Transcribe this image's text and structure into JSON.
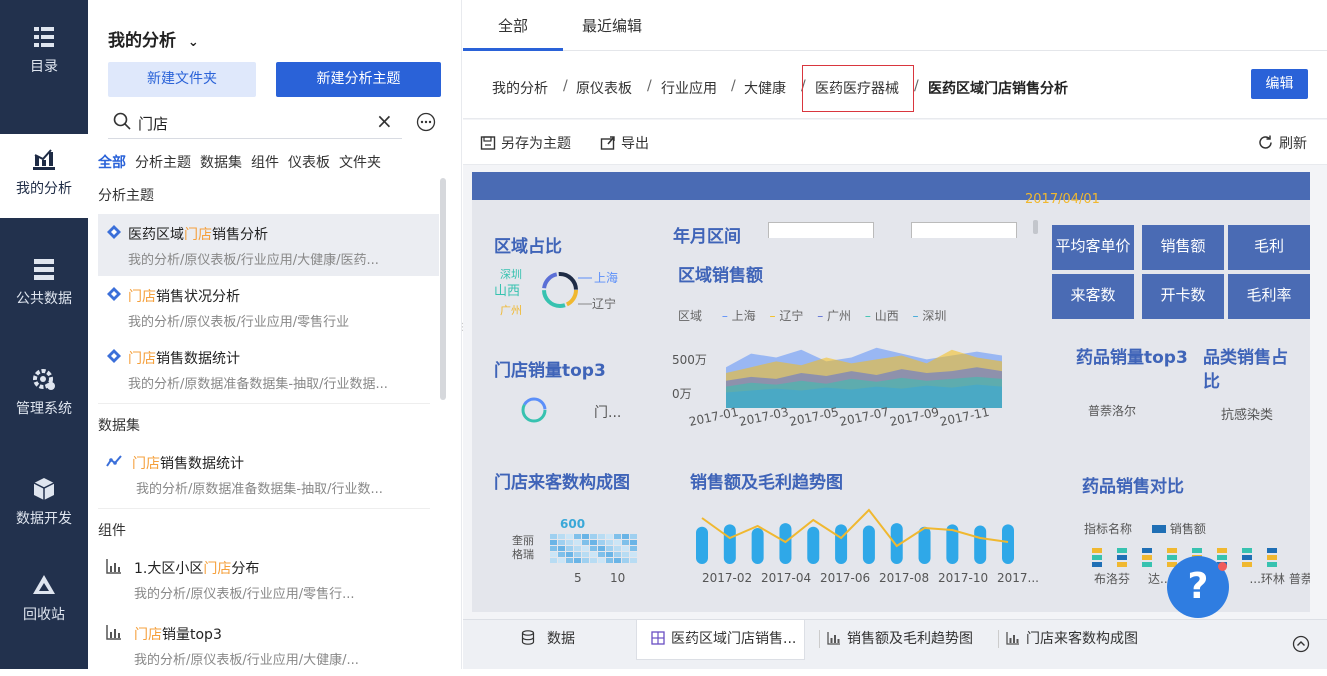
{
  "nav": {
    "items": [
      {
        "label": "目录",
        "icon": "catalog-icon"
      },
      {
        "label": "我的分析",
        "icon": "analysis-icon"
      },
      {
        "label": "公共数据",
        "icon": "public-data-icon"
      },
      {
        "label": "管理系统",
        "icon": "manage-system-icon"
      },
      {
        "label": "数据开发",
        "icon": "data-dev-icon"
      },
      {
        "label": "回收站",
        "icon": "recycle-bin-icon"
      }
    ]
  },
  "panel": {
    "title": "我的分析",
    "new_folder": "新建文件夹",
    "new_subject": "新建分析主题",
    "search_value": "门店",
    "filters": [
      "全部",
      "分析主题",
      "数据集",
      "组件",
      "仪表板",
      "文件夹"
    ],
    "sections": {
      "subjects": "分析主题",
      "datasets": "数据集",
      "components": "组件"
    },
    "results": [
      {
        "pre": "医药区域",
        "hl": "门店",
        "post": "销售分析",
        "path": "我的分析/原仪表板/行业应用/大健康/医药..."
      },
      {
        "pre": "",
        "hl": "门店",
        "post": "销售状况分析",
        "path": "我的分析/原仪表板/行业应用/零售行业"
      },
      {
        "pre": "",
        "hl": "门店",
        "post": "销售数据统计",
        "path": "我的分析/原数据准备数据集-抽取/行业数据..."
      },
      {
        "pre": "",
        "hl": "门店",
        "post": "销售数据统计",
        "path": "我的分析/原数据准备数据集-抽取/行业数..."
      },
      {
        "pre": "1.大区小区",
        "hl": "门店",
        "post": "分布",
        "path": "我的分析/原仪表板/行业应用/零售行..."
      },
      {
        "pre": "",
        "hl": "门店",
        "post": "销量top3",
        "path": "我的分析/原仪表板/行业应用/大健康/..."
      }
    ]
  },
  "main": {
    "tabs": [
      "全部",
      "最近编辑"
    ],
    "breadcrumb": [
      "我的分析",
      "原仪表板",
      "行业应用",
      "大健康",
      "医药医疗器械",
      "医药区域门店销售分析"
    ],
    "edit": "编辑",
    "toolbar": {
      "save_as": "另存为主题",
      "export": "导出",
      "refresh": "刷新"
    }
  },
  "dashboard": {
    "date": "2017/04/01",
    "w_region_ratio": "区域占比",
    "w_year_month": "年月区间",
    "w_region_sales": "区域销售额",
    "legend_title": "区域",
    "w_top3": "门店销量top3",
    "w_top3_item": "门...",
    "w_drug_top3": "药品销量top3",
    "w_category": "品类销售占比",
    "w_category_item": "抗感染类",
    "w_drug_item": "普萘洛尔",
    "w_visitors": "门店来客数构成图",
    "w_trend": "销售额及毛利趋势图",
    "w_compare": "药品销售对比",
    "cmp_legend_a": "指标名称",
    "cmp_legend_b": "销售额",
    "cmp_labels": [
      "布洛芬",
      "达...",
      "...环林",
      "普萘..."
    ],
    "kpis": [
      "平均客单价",
      "销售额",
      "毛利",
      "来客数",
      "开卡数",
      "毛利率"
    ],
    "donut_labels": {
      "shanghai": "上海",
      "shanxi": "山西",
      "liaoning": "辽宁",
      "guangzhou": "广州",
      "shenzhen": "深圳"
    },
    "heatmap": {
      "top": "600",
      "row1": "奎丽",
      "row2": "格瑞",
      "x1": "5",
      "x2": "10"
    }
  },
  "chart_data": [
    {
      "type": "area",
      "title": "区域销售额",
      "series": [
        {
          "name": "上海",
          "values": [
            420,
            560,
            520,
            600,
            480,
            520,
            620,
            560,
            500,
            540,
            580,
            540
          ]
        },
        {
          "name": "辽宁",
          "values": [
            360,
            420,
            480,
            440,
            520,
            460,
            500,
            540,
            460,
            600,
            520,
            480
          ]
        },
        {
          "name": "广州",
          "values": [
            280,
            320,
            300,
            360,
            330,
            380,
            340,
            400,
            360,
            380,
            420,
            380
          ]
        },
        {
          "name": "山西",
          "values": [
            220,
            260,
            240,
            280,
            250,
            300,
            270,
            310,
            280,
            300,
            320,
            300
          ]
        },
        {
          "name": "深圳",
          "values": [
            160,
            180,
            200,
            180,
            210,
            190,
            220,
            200,
            230,
            210,
            240,
            220
          ]
        }
      ],
      "series_colors": [
        "#5b8ff9",
        "#f6bd16",
        "#5b6fd6",
        "#37c2b0",
        "#3aa8d8"
      ],
      "x": [
        "2017-01",
        "2017-02",
        "2017-03",
        "2017-04",
        "2017-05",
        "2017-06",
        "2017-07",
        "2017-08",
        "2017-09",
        "2017-10",
        "2017-11",
        "2017-12"
      ],
      "x_tick_labels": [
        "2017-01",
        "2017-03",
        "2017-05",
        "2017-07",
        "2017-09",
        "2017-11"
      ],
      "y_tick_labels": [
        "500万",
        "0万"
      ],
      "ylim": [
        0,
        700
      ]
    },
    {
      "type": "bar",
      "title": "销售额及毛利趋势图",
      "x": [
        "2017-01",
        "2017-02",
        "2017-03",
        "2017-04",
        "2017-05",
        "2017-06",
        "2017-07",
        "2017-08",
        "2017-09",
        "2017-10",
        "2017-11",
        "2017-12"
      ],
      "x_tick_labels": [
        "2017-02",
        "2017-04",
        "2017-06",
        "2017-08",
        "2017-10",
        "2017..."
      ],
      "series": [
        {
          "name": "销售额",
          "values": [
            60,
            64,
            58,
            66,
            60,
            64,
            62,
            66,
            60,
            64,
            62,
            64
          ]
        },
        {
          "name": "毛利",
          "values": [
            72,
            52,
            64,
            48,
            70,
            52,
            80,
            44,
            62,
            60,
            52,
            48
          ]
        }
      ],
      "colors": {
        "bar": "#2fa8e8",
        "line": "#f0b830"
      }
    }
  ],
  "bottom": {
    "tabs": [
      "数据",
      "医药区域门店销售...",
      "销售额及毛利趋势图",
      "门店来客数构成图"
    ]
  },
  "colors": {
    "accent": "#2a62d8",
    "highlight": "#f5a03c",
    "nav_bg": "#22314d",
    "dashboard_blue": "#4a6bb4"
  }
}
